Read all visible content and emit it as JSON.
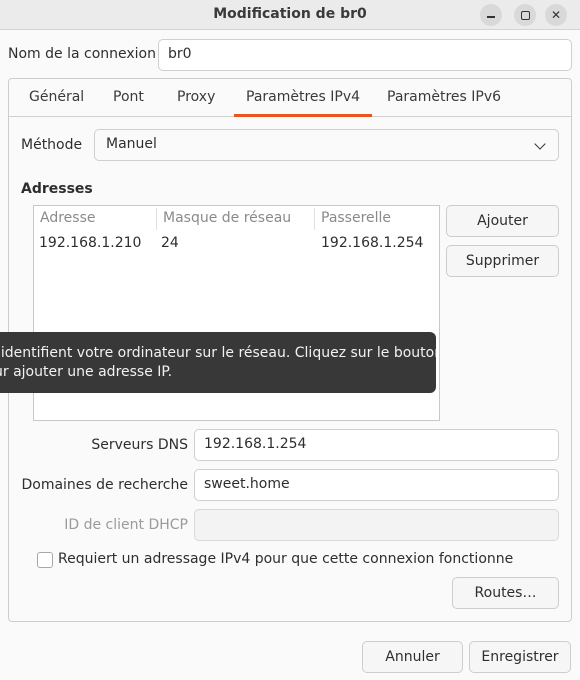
{
  "window": {
    "title": "Modification de br0"
  },
  "connection": {
    "name_label": "Nom de la connexion",
    "name_value": "br0"
  },
  "tabs": [
    {
      "label": "Général"
    },
    {
      "label": "Pont"
    },
    {
      "label": "Proxy"
    },
    {
      "label": "Paramètres IPv4",
      "active": true
    },
    {
      "label": "Paramètres IPv6"
    }
  ],
  "ipv4": {
    "method_label": "Méthode",
    "method_value": "Manuel",
    "addresses_title": "Adresses",
    "columns": [
      "Adresse",
      "Masque de réseau",
      "Passerelle"
    ],
    "rows": [
      {
        "address": "192.168.1.210",
        "netmask": "24",
        "gateway": "192.168.1.254"
      }
    ],
    "add_label": "Ajouter",
    "delete_label": "Supprimer",
    "tooltip_line1": "P identifient votre ordinateur sur le réseau. Cliquez sur le bouton",
    "tooltip_line2": "ur ajouter une adresse IP.",
    "dns_label": "Serveurs DNS",
    "dns_value": "192.168.1.254",
    "search_label": "Domaines de recherche",
    "search_value": "sweet.home",
    "dhcp_label": "ID de client DHCP",
    "dhcp_value": "",
    "require_label": "Requiert un adressage IPv4 pour que cette connexion fonctionne",
    "routes_label": "Routes…"
  },
  "footer": {
    "cancel_label": "Annuler",
    "save_label": "Enregistrer"
  },
  "colors": {
    "accent": "#e95420",
    "tooltip_bg": "#383838"
  }
}
